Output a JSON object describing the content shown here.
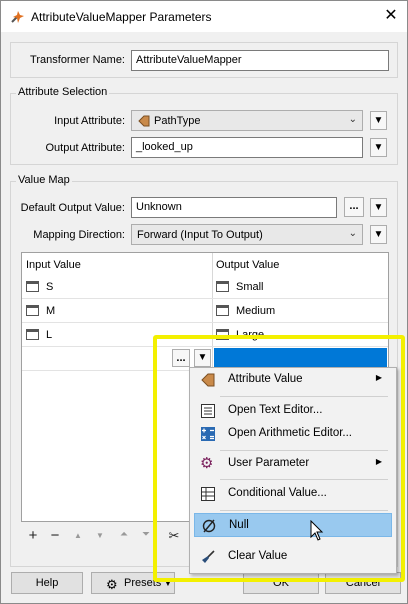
{
  "window": {
    "title": "AttributeValueMapper Parameters",
    "close_glyph": "✕"
  },
  "transformer": {
    "label": "Transformer Name:",
    "value": "AttributeValueMapper"
  },
  "attribute_selection": {
    "legend": "Attribute Selection",
    "input_label": "Input Attribute:",
    "input_value": "PathType",
    "output_label": "Output Attribute:",
    "output_value": "_looked_up"
  },
  "value_map": {
    "legend": "Value Map",
    "default_label": "Default Output Value:",
    "default_value": "Unknown",
    "direction_label": "Mapping Direction:",
    "direction_value": "Forward (Input To Output)",
    "table": {
      "col_input": "Input Value",
      "col_output": "Output Value",
      "rows": [
        {
          "input": "S",
          "output": "Small"
        },
        {
          "input": "M",
          "output": "Medium"
        },
        {
          "input": "L",
          "output": "Large"
        }
      ]
    }
  },
  "toolbar": {
    "add": "+",
    "remove": "−",
    "move_up": "▲",
    "move_down": "▼",
    "move_top": "⏶",
    "move_bottom": "⏷",
    "cut": "✂"
  },
  "buttons": {
    "help": "Help",
    "presets": "Presets",
    "ok": "OK",
    "cancel": "Cancel"
  },
  "menu": {
    "items": [
      {
        "label": "Attribute Value",
        "icon": "attribute-icon",
        "submenu": true
      },
      {
        "label": "Open Text Editor...",
        "icon": "text-editor-icon"
      },
      {
        "label": "Open Arithmetic Editor...",
        "icon": "arithmetic-editor-icon"
      },
      {
        "label": "User Parameter",
        "icon": "gear-icon",
        "submenu": true
      },
      {
        "label": "Conditional Value...",
        "icon": "table-icon"
      },
      {
        "label": "Null",
        "icon": "null-icon",
        "selected": true
      },
      {
        "label": "Clear Value",
        "icon": "broom-icon"
      }
    ]
  },
  "colors": {
    "accent": "#0078d7",
    "highlight": "#99c9ef",
    "annotation": "#f3f000"
  },
  "dots_label": "...",
  "dropdown_arrow": "▼"
}
